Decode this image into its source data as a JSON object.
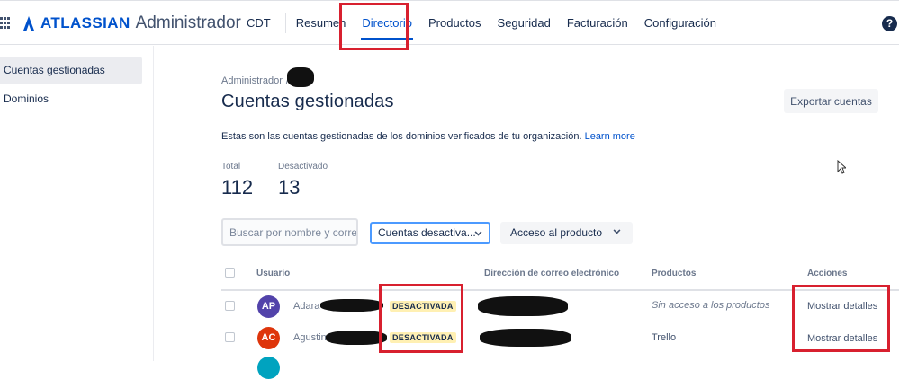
{
  "header": {
    "brand": "ATLASSIAN",
    "product": "Administrador",
    "nav": [
      {
        "label": "CDT"
      },
      {
        "label": "Resumen"
      },
      {
        "label": "Directorio"
      },
      {
        "label": "Productos"
      },
      {
        "label": "Seguridad"
      },
      {
        "label": "Facturación"
      },
      {
        "label": "Configuración"
      }
    ],
    "active_nav": "Directorio",
    "help": "?"
  },
  "sidebar": {
    "items": [
      {
        "label": "Cuentas gestionadas"
      },
      {
        "label": "Dominios"
      }
    ],
    "active": "Cuentas gestionadas"
  },
  "main": {
    "breadcrumb_root": "Administrador",
    "breadcrumb_sep": "/",
    "title": "Cuentas gestionadas",
    "export_button": "Exportar cuentas",
    "description": "Estas son las cuentas gestionadas de los dominios verificados de tu organización.",
    "learn_more": "Learn more",
    "stats": {
      "total_label": "Total",
      "total_value": "112",
      "deactivated_label": "Desactivado",
      "deactivated_value": "13"
    },
    "search_placeholder": "Buscar por nombre y correo",
    "filter_status": "Cuentas desactiva...",
    "filter_product": "Acceso al producto"
  },
  "table": {
    "columns": {
      "user": "Usuario",
      "email": "Dirección de correo electrónico",
      "products": "Productos",
      "actions": "Acciones"
    },
    "rows": [
      {
        "initials": "AP",
        "name": "Adara",
        "status": "DESACTIVADA",
        "products": "Sin acceso a los productos",
        "action": "Mostrar detalles"
      },
      {
        "initials": "AC",
        "name": "Agustin",
        "status": "DESACTIVADA",
        "products": "Trello",
        "action": "Mostrar detalles"
      }
    ]
  },
  "colors": {
    "brand_blue": "#0052cc",
    "highlight_red": "#d8202f",
    "avatar_ap": "#5243aa",
    "avatar_ac": "#de350b",
    "lozenge_bg": "#fff0b3"
  }
}
